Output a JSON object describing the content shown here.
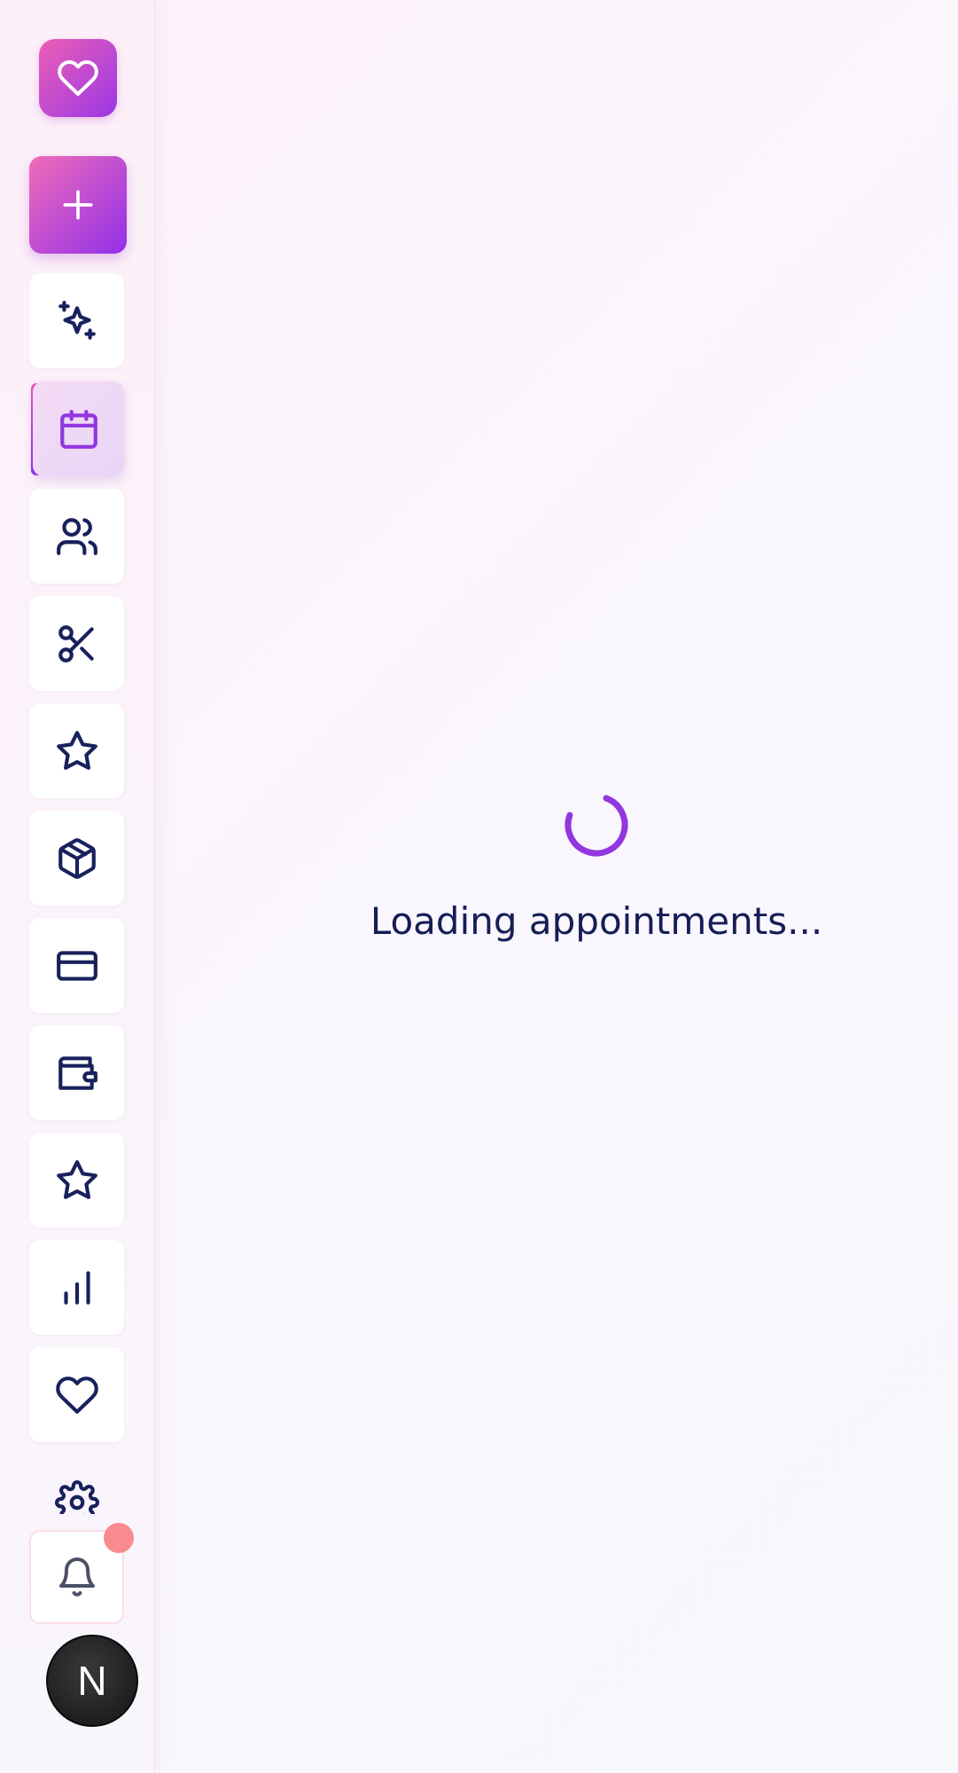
{
  "sidebar": {
    "logo_icon": "heart-icon",
    "add_icon": "plus-icon",
    "items": [
      {
        "name": "ai-assistant",
        "icon": "sparkles-icon"
      },
      {
        "name": "appointments",
        "icon": "calendar-icon",
        "active": true
      },
      {
        "name": "clients",
        "icon": "users-icon"
      },
      {
        "name": "services",
        "icon": "scissors-icon"
      },
      {
        "name": "reviews",
        "icon": "star-icon"
      },
      {
        "name": "products",
        "icon": "box-icon"
      },
      {
        "name": "payments",
        "icon": "credit-card-icon"
      },
      {
        "name": "wallet",
        "icon": "wallet-icon"
      },
      {
        "name": "loyalty",
        "icon": "star-icon"
      },
      {
        "name": "analytics",
        "icon": "bar-chart-icon"
      },
      {
        "name": "favorites",
        "icon": "heart-icon"
      },
      {
        "name": "settings",
        "icon": "gear-icon"
      }
    ],
    "notifications_icon": "bell-icon",
    "avatar_initial": "N"
  },
  "main": {
    "loading_text": "Loading appointments..."
  },
  "colors": {
    "accent_pink": "#ec5fb6",
    "accent_purple": "#9236df",
    "icon_navy": "#18215c",
    "text_navy": "#151e55",
    "notification_dot": "#f98a8f"
  }
}
